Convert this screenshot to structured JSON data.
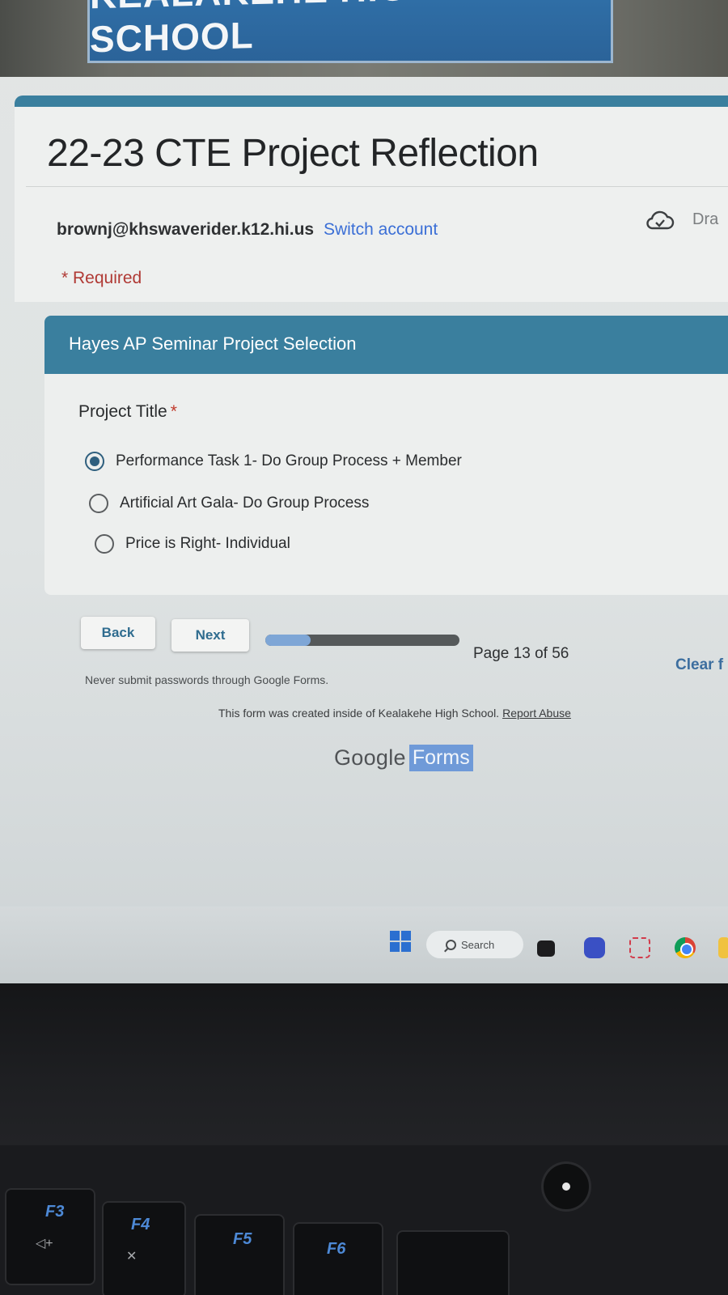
{
  "banner": {
    "text": "KEALAKEHE HIGH SCHOOL"
  },
  "form": {
    "title": "22-23 CTE Project Reflection",
    "account_email": "brownj@khswaverider.k12.hi.us",
    "switch_account": "Switch account",
    "draft_label": "Dra",
    "required_note": "* Required"
  },
  "section": {
    "title": "Hayes AP Seminar Project Selection",
    "question": "Project Title",
    "required_star": "*",
    "options": [
      {
        "label": "Performance Task 1- Do Group Process + Member",
        "selected": true
      },
      {
        "label": "Artificial Art Gala- Do Group Process",
        "selected": false
      },
      {
        "label": "Price is Right- Individual",
        "selected": false
      }
    ]
  },
  "navigation": {
    "back_label": "Back",
    "next_label": "Next",
    "progress_fraction": 0.232,
    "page_indicator": "Page 13 of 56",
    "clear_label": "Clear f"
  },
  "footer": {
    "password_note": "Never submit passwords through Google Forms.",
    "created_note": "This form was created inside of Kealakehe High School.",
    "report_abuse": "Report Abuse",
    "brand_google": "Google",
    "brand_forms": "Forms"
  },
  "taskbar": {
    "search_label": "Search",
    "icons": [
      "windows-start-icon",
      "search-icon",
      "widgets-icon",
      "teams-icon",
      "snipping-tool-icon",
      "chrome-icon",
      "file-explorer-icon"
    ]
  },
  "keyboard": {
    "keys": [
      {
        "label": "F3",
        "sub": "◁+"
      },
      {
        "label": "F4",
        "sub": "✕"
      },
      {
        "label": "F5",
        "sub": ""
      },
      {
        "label": "F6",
        "sub": ""
      }
    ]
  },
  "colors": {
    "theme_teal": "#3a7f9e",
    "link_blue": "#3b6fd6",
    "required_red": "#b03a35",
    "progress_fill": "#7ea6d6",
    "progress_track": "#55595a"
  }
}
